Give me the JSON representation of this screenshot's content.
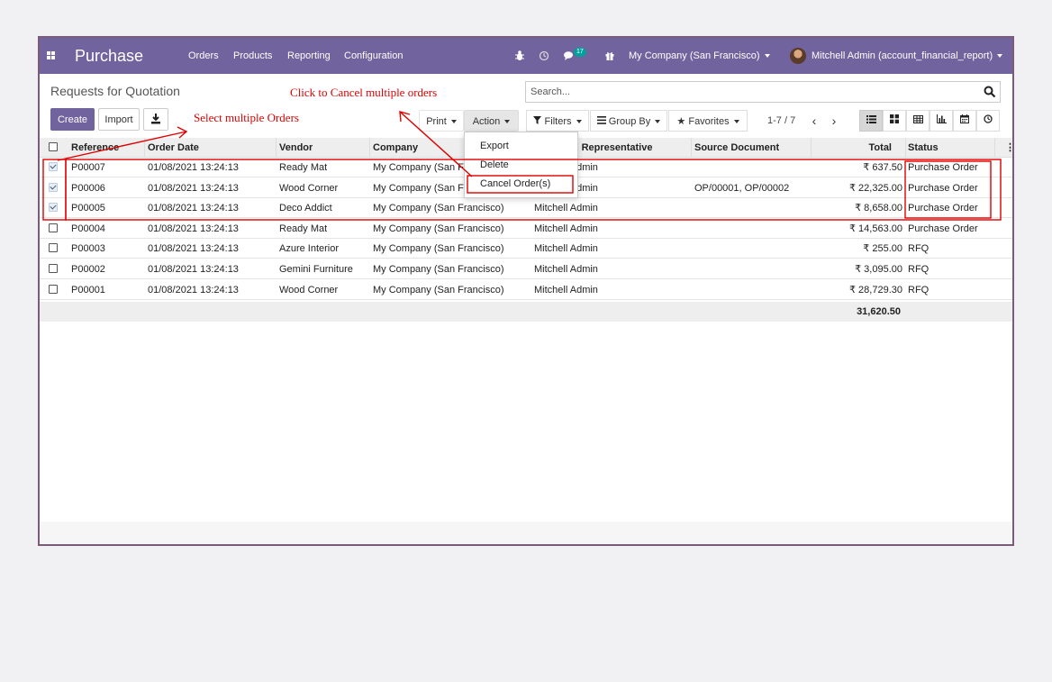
{
  "navbar": {
    "app_title": "Purchase",
    "menu": [
      "Orders",
      "Products",
      "Reporting",
      "Configuration"
    ],
    "messages_count": "17",
    "company": "My Company (San Francisco)",
    "user": "Mitchell Admin (account_financial_report)",
    "icons": [
      "apps-grid-icon",
      "bug-icon",
      "clock-icon",
      "chat-icon",
      "gift-icon"
    ]
  },
  "control_panel": {
    "breadcrumb": "Requests for Quotation",
    "create_label": "Create",
    "import_label": "Import",
    "print_label": "Print",
    "action_label": "Action",
    "search_placeholder": "Search...",
    "filters_label": "Filters",
    "group_by_label": "Group By",
    "favorites_label": "Favorites",
    "pager_value": "1-7 / 7"
  },
  "action_menu": {
    "items": [
      "Export",
      "Delete",
      "Cancel Order(s)"
    ]
  },
  "table": {
    "columns": [
      "Reference",
      "Order Date",
      "Vendor",
      "Company",
      "Purchase Representative",
      "Source Document",
      "Total",
      "Status"
    ],
    "rows": [
      {
        "checked": true,
        "cells": [
          "P00007",
          "01/08/2021 13:24:13",
          "Ready Mat",
          "My Company (San Francisco)",
          "Mitchell Admin",
          "",
          "₹ 637.50",
          "Purchase Order"
        ]
      },
      {
        "checked": true,
        "cells": [
          "P00006",
          "01/08/2021 13:24:13",
          "Wood Corner",
          "My Company (San Francisco)",
          "Mitchell Admin",
          "OP/00001, OP/00002",
          "₹ 22,325.00",
          "Purchase Order"
        ]
      },
      {
        "checked": true,
        "cells": [
          "P00005",
          "01/08/2021 13:24:13",
          "Deco Addict",
          "My Company (San Francisco)",
          "Mitchell Admin",
          "",
          "₹ 8,658.00",
          "Purchase Order"
        ]
      },
      {
        "checked": false,
        "cells": [
          "P00004",
          "01/08/2021 13:24:13",
          "Ready Mat",
          "My Company (San Francisco)",
          "Mitchell Admin",
          "",
          "₹ 14,563.00",
          "Purchase Order"
        ]
      },
      {
        "checked": false,
        "cells": [
          "P00003",
          "01/08/2021 13:24:13",
          "Azure Interior",
          "My Company (San Francisco)",
          "Mitchell Admin",
          "",
          "₹ 255.00",
          "RFQ"
        ]
      },
      {
        "checked": false,
        "cells": [
          "P00002",
          "01/08/2021 13:24:13",
          "Gemini Furniture",
          "My Company (San Francisco)",
          "Mitchell Admin",
          "",
          "₹ 3,095.00",
          "RFQ"
        ]
      },
      {
        "checked": false,
        "cells": [
          "P00001",
          "01/08/2021 13:24:13",
          "Wood Corner",
          "My Company (San Francisco)",
          "Mitchell Admin",
          "",
          "₹ 28,729.30",
          "RFQ"
        ]
      }
    ],
    "total_sum": "31,620.50"
  },
  "annotations": {
    "select_orders": "Select multiple Orders",
    "cancel_orders": "Click to Cancel multiple orders",
    "color": "#e00000"
  },
  "colors": {
    "brand": "#71639e",
    "badge": "#00a09d"
  }
}
